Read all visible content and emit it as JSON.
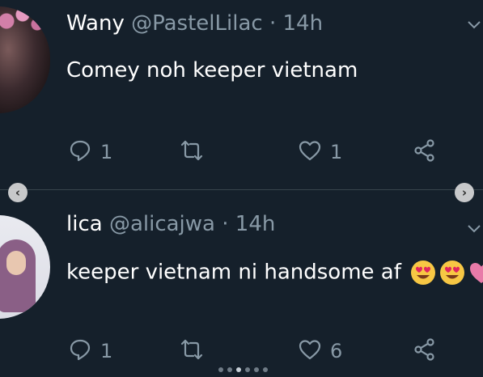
{
  "colors": {
    "background": "#15202b",
    "text": "#ffffff",
    "muted": "#8899a6",
    "divider": "#38444d"
  },
  "tweets": [
    {
      "name": "Wany",
      "handle": "@PastelLilac",
      "separator": "·",
      "time": "14h",
      "text": "Comey noh keeper vietnam",
      "reply_count": "1",
      "retweet_count": "",
      "like_count": "1",
      "emojis": []
    },
    {
      "name": "lica",
      "handle": "@alicajwa",
      "separator": "·",
      "time": "14h",
      "text": "keeper vietnam ni handsome af",
      "reply_count": "1",
      "retweet_count": "",
      "like_count": "6",
      "emojis": [
        "heart-eyes-emoji",
        "heart-eyes-emoji",
        "pink-heart-emoji"
      ]
    }
  ],
  "carousel": {
    "dots": 6,
    "active_index": 2
  },
  "icons": [
    "reply-icon",
    "retweet-icon",
    "like-icon",
    "share-icon",
    "chevron-down-icon",
    "nav-left-arrow-icon",
    "nav-right-arrow-icon"
  ]
}
